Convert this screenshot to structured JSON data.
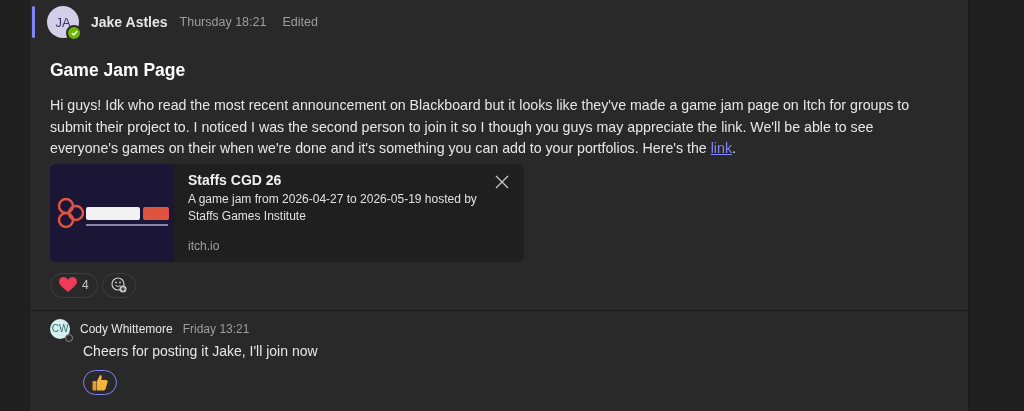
{
  "messages": [
    {
      "author": "Jake Astles",
      "initials": "JA",
      "available": true,
      "time": "Thursday 18:21",
      "edited": "Edited",
      "subject": "Game Jam Page",
      "body": "Hi guys! Idk who read the most recent announcement on Blackboard but it looks like they've made a game jam page on Itch for groups to submit their project to. I noticed I was the second person to join it so I though you guys may appreciate the link. We'll be able to see everyone's games on their when we're done and it's something you can add to your portfolios. Here's the ",
      "link": "link",
      "after_link": ".",
      "preview": {
        "kind": "picture",
        "title": "Staffs CGD 26",
        "description": "A game jam from 2026-04-27 to 2026-05-19 hosted by Staffs Games Institute",
        "domain": "itch.io"
      },
      "reactions": [
        {
          "kind": "heart",
          "count": "4",
          "selected": false
        }
      ],
      "add_reaction": true
    },
    {
      "author": "Cody Whittemore",
      "initials": "CW",
      "available": false,
      "time": "Friday 13:21",
      "body": "Cheers for posting it Jake, I'll join now",
      "reactions": [
        {
          "kind": "thumbs-up",
          "selected": true
        }
      ]
    }
  ]
}
